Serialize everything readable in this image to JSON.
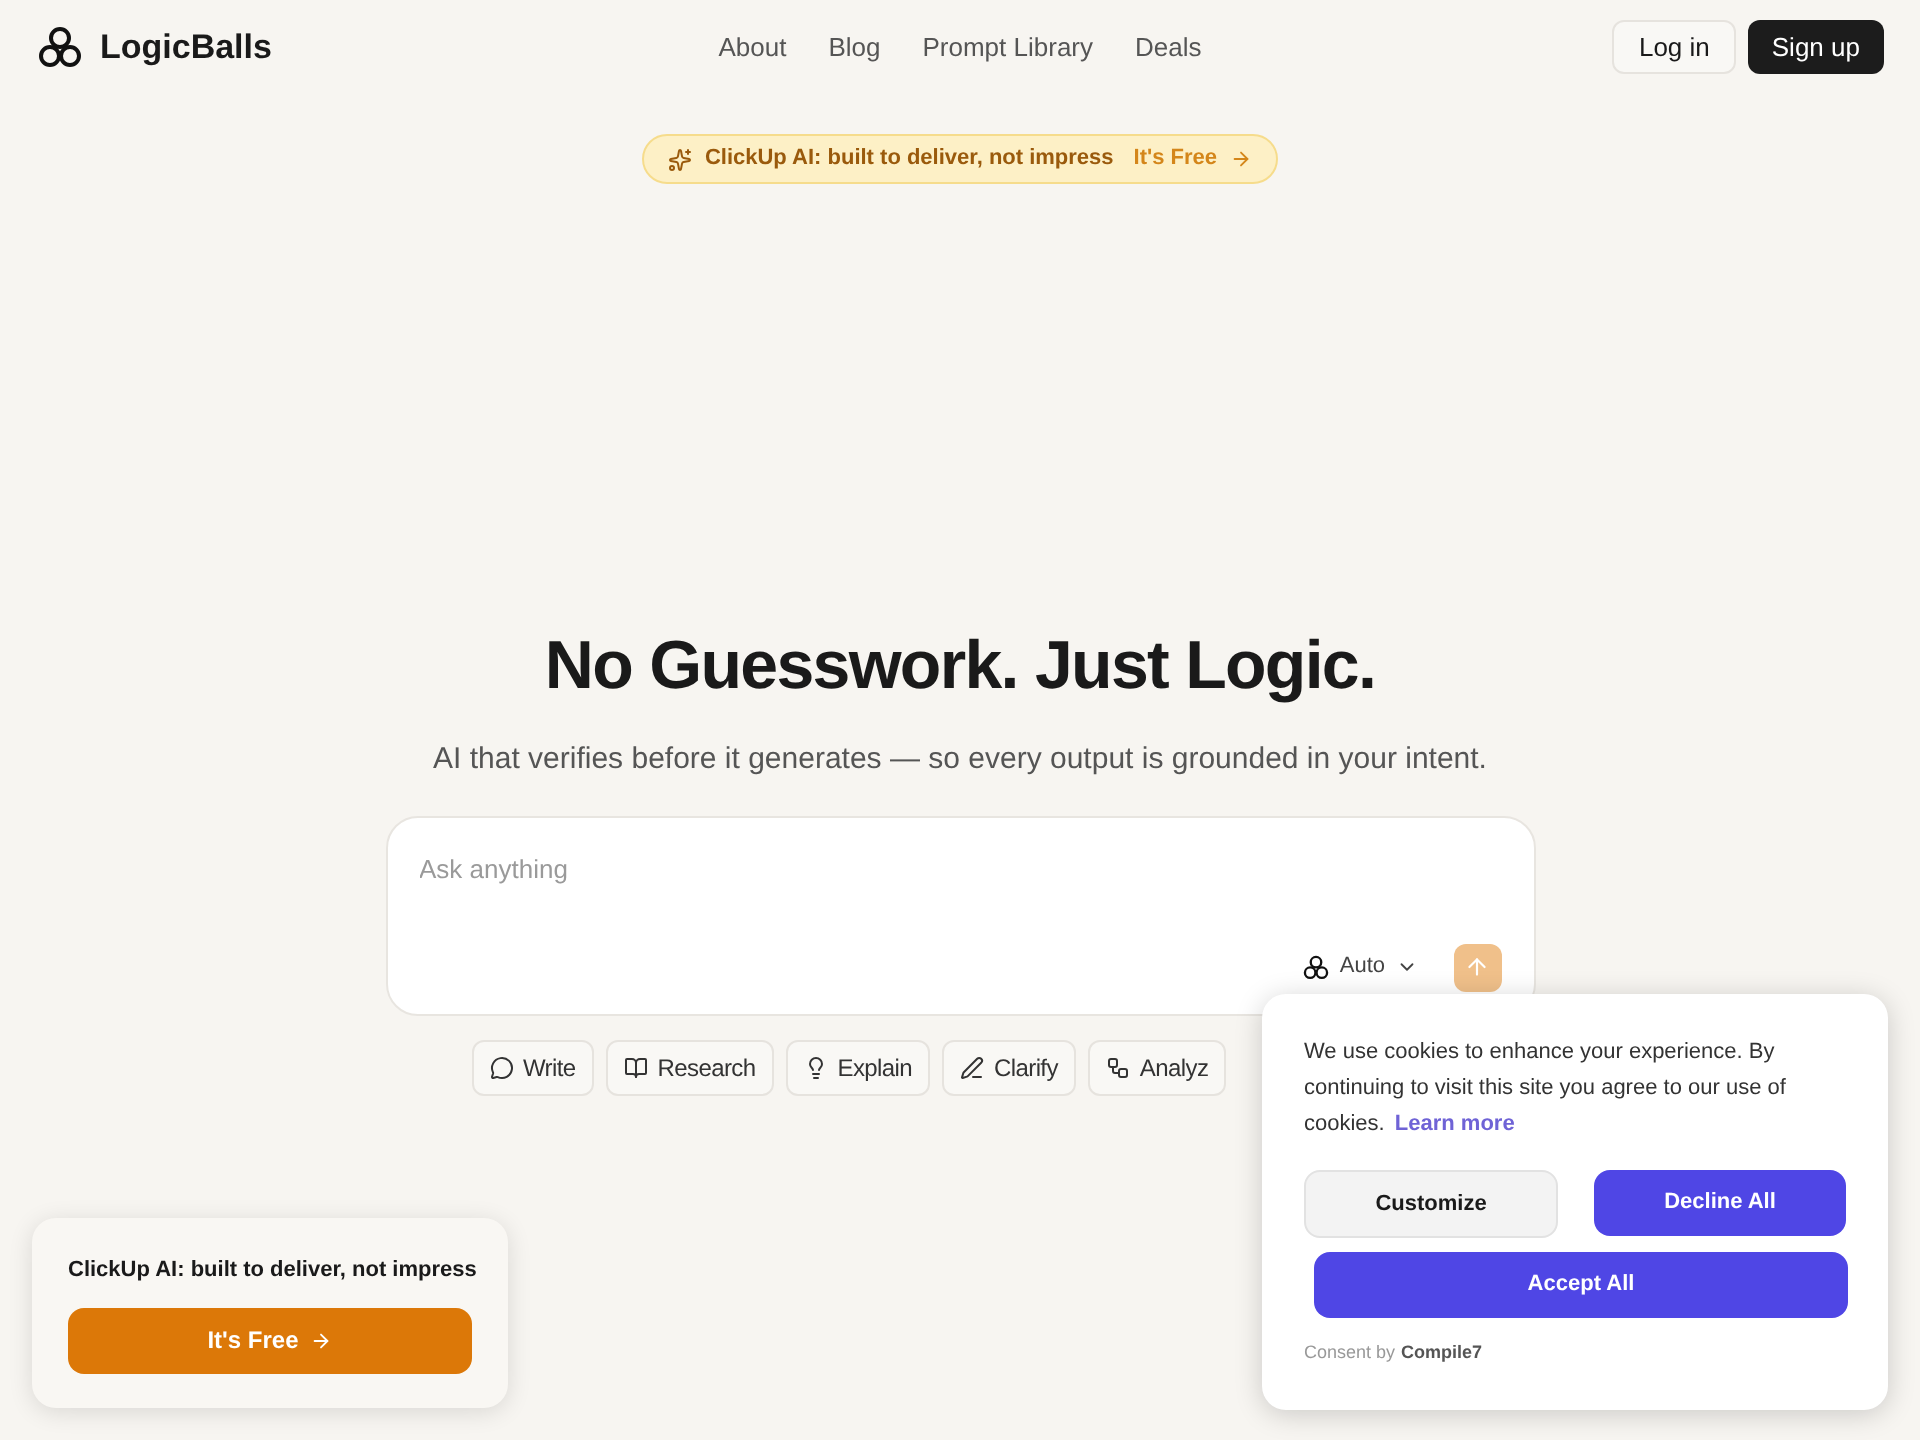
{
  "brand": "LogicBalls",
  "nav": [
    {
      "label": "About"
    },
    {
      "label": "Blog"
    },
    {
      "label": "Prompt Library"
    },
    {
      "label": "Deals"
    }
  ],
  "auth": {
    "login": "Log in",
    "signup": "Sign up"
  },
  "banner": {
    "text": "ClickUp AI: built to deliver, not impress",
    "cta": "It's Free"
  },
  "hero": {
    "title": "No Guesswork. Just Logic.",
    "subtitle": "AI that verifies before it generates — so every output is grounded in your intent."
  },
  "prompt": {
    "placeholder": "Ask anything",
    "model": "Auto"
  },
  "chips": [
    {
      "label": "Write",
      "kind": "chat"
    },
    {
      "label": "Research",
      "kind": "book"
    },
    {
      "label": "Explain",
      "kind": "bulb"
    },
    {
      "label": "Clarify",
      "kind": "pen"
    },
    {
      "label": "Analyz",
      "kind": "nodes"
    }
  ],
  "promo": {
    "text": "ClickUp AI: built to deliver, not impress",
    "button": "It's Free"
  },
  "cookie": {
    "text": "We use cookies to enhance your experience. By continuing to visit this site you agree to our use of cookies.",
    "link": "Learn more",
    "customize": "Customize",
    "decline": "Decline All",
    "accept": "Accept All",
    "consent_prefix": "Consent by",
    "consent_brand": "Compile7"
  }
}
